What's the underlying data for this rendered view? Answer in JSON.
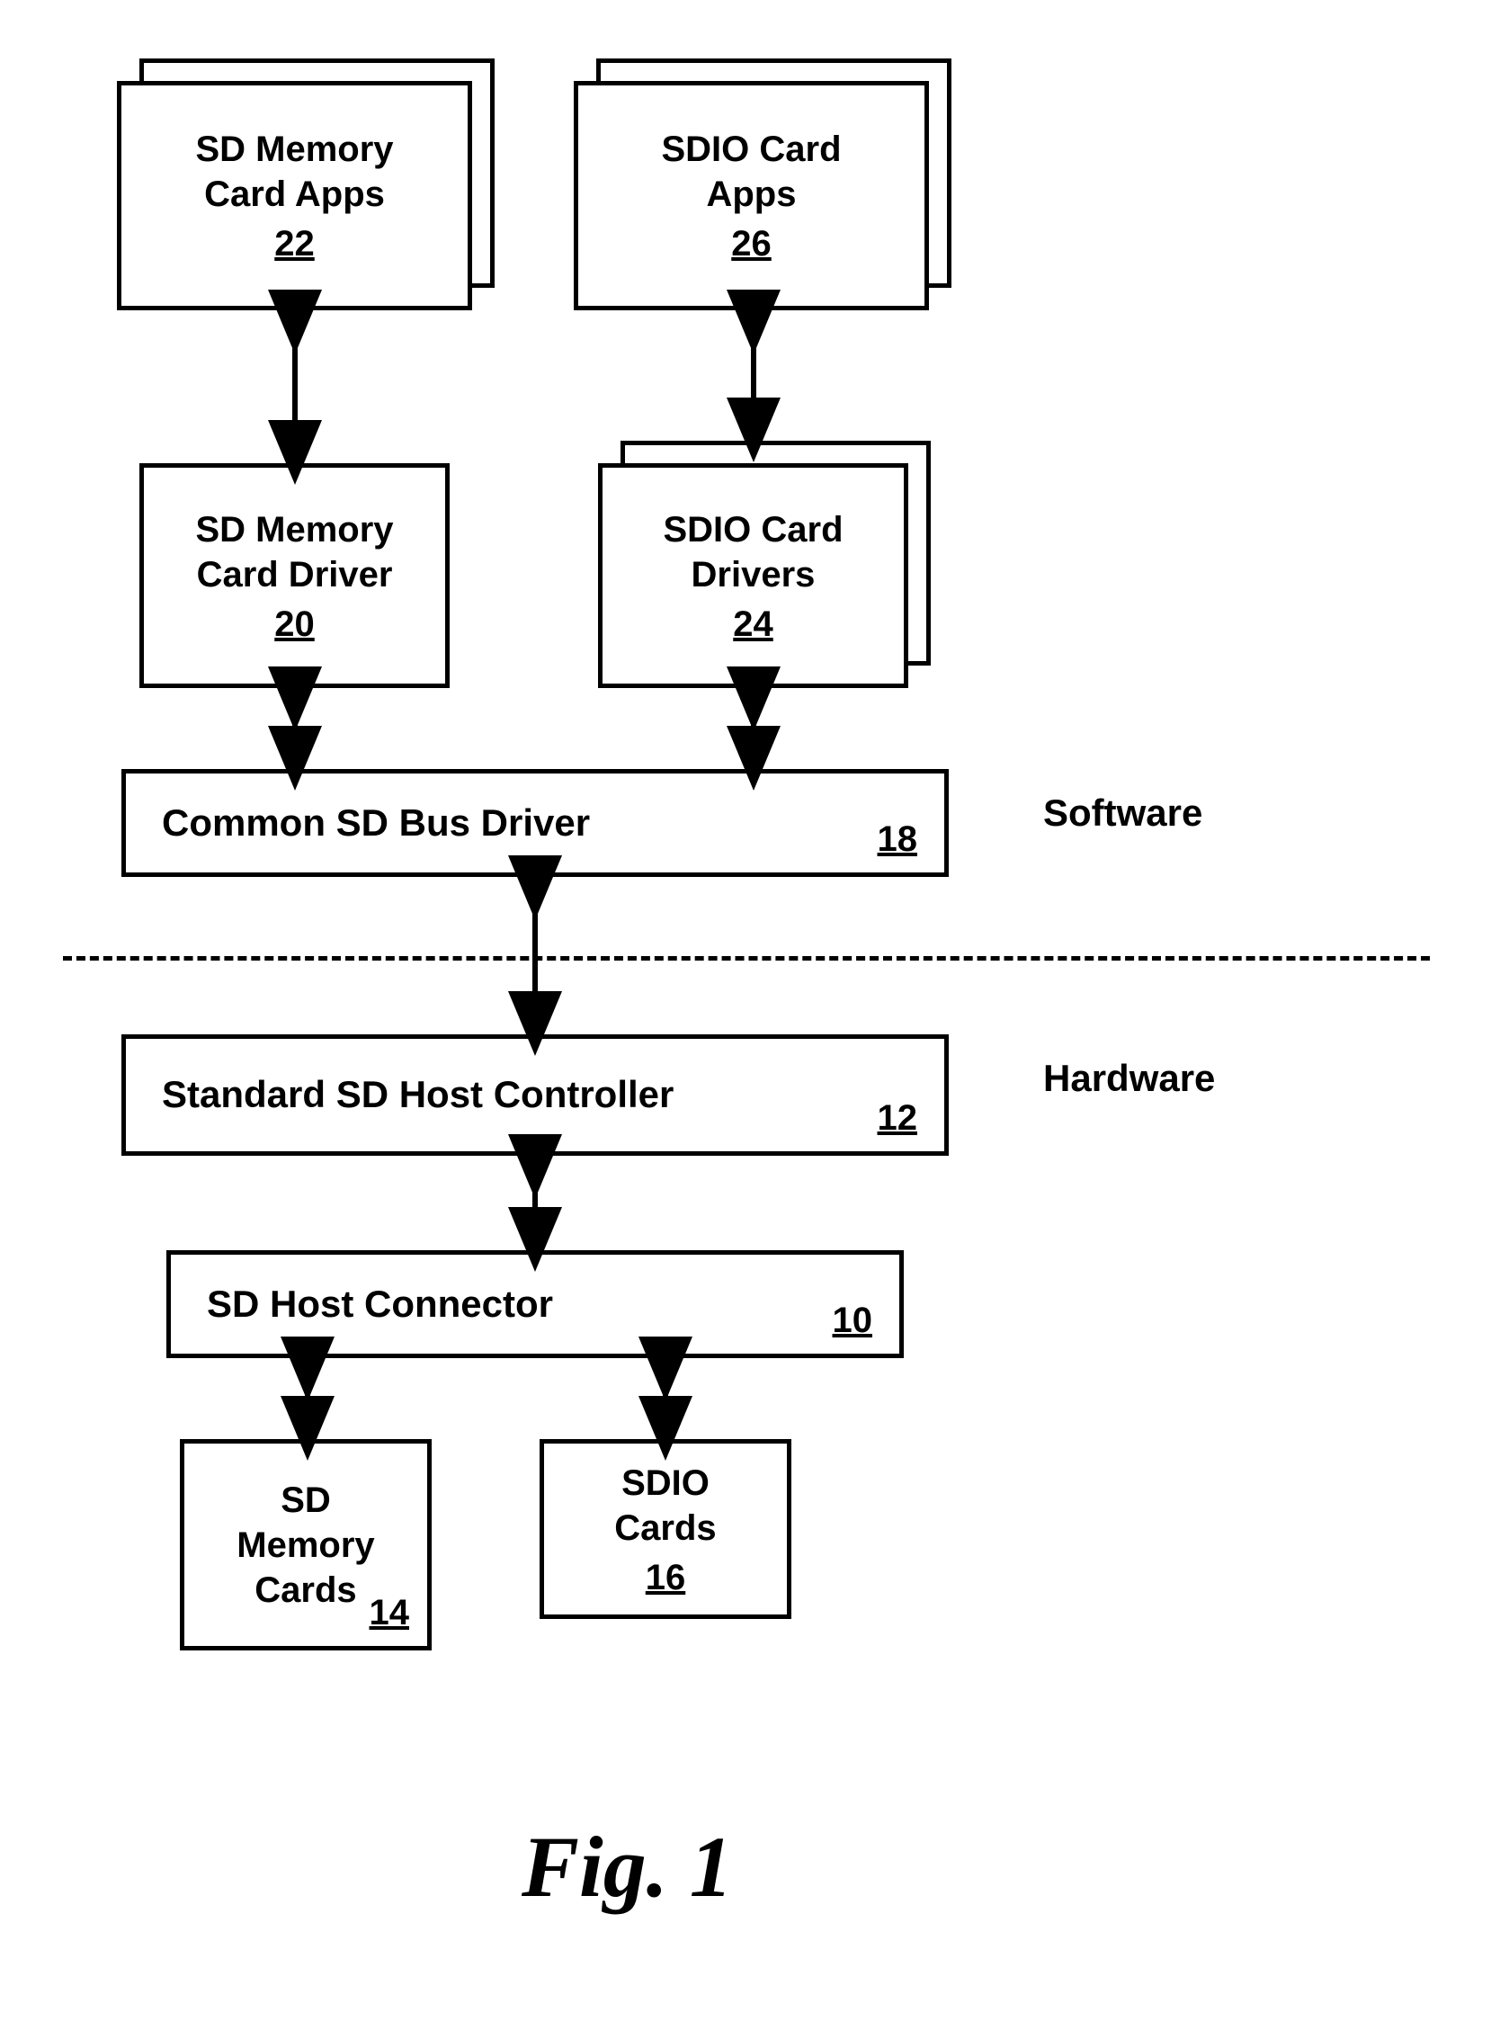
{
  "caption": "Fig. 1",
  "labels": {
    "software": "Software",
    "hardware": "Hardware"
  },
  "boxes": {
    "sd_mem_apps": {
      "title": "SD Memory\nCard Apps",
      "num": "22"
    },
    "sdio_apps": {
      "title": "SDIO Card\nApps",
      "num": "26"
    },
    "sd_mem_driver": {
      "title": "SD Memory\nCard Driver",
      "num": "20"
    },
    "sdio_drivers": {
      "title": "SDIO Card\nDrivers",
      "num": "24"
    },
    "bus_driver": {
      "title": "Common SD Bus Driver",
      "num": "18"
    },
    "host_ctrl": {
      "title": "Standard SD Host Controller",
      "num": "12"
    },
    "host_conn": {
      "title": "SD Host Connector",
      "num": "10"
    },
    "sd_cards": {
      "title": "SD\nMemory\nCards",
      "num": "14"
    },
    "sdio_cards": {
      "title": "SDIO\nCards",
      "num": "16"
    }
  }
}
